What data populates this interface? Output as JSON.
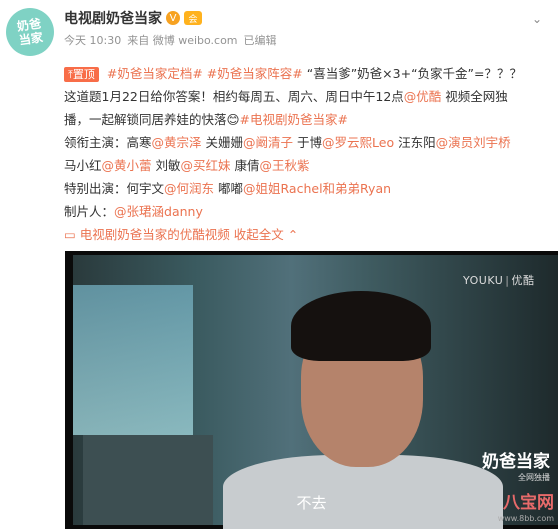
{
  "post": {
    "avatar_text": "奶爸当家",
    "username": "电视剧奶爸当家",
    "verified_badge": "V",
    "vip_badge": "会",
    "meta": {
      "time": "今天 10:30",
      "source": "来自 微博 weibo.com",
      "edited": "已编辑"
    },
    "more_icon": "chevron-down-icon"
  },
  "content": {
    "pin_label": "置顶",
    "line1": {
      "tag1": "#奶爸当家定档#",
      "tag2": "#奶爸当家阵容#",
      "text": "“喜当爹”奶爸×3+“负家千金”=？？？"
    },
    "line2": {
      "text": "这道题1月22日给你答案！相约每周五、周六、周日中午12点",
      "mention": "@优酷",
      "text2": " 视频全网独"
    },
    "line3": {
      "text": "播，一起解锁同居养娃的快落",
      "emoji": "😊",
      "tag": "#电视剧奶爸当家#"
    },
    "line4": {
      "label": "领衔主演：高寒",
      "m1": "@黄宗泽",
      "t1": " 关姗姗",
      "m2": "@阚清子",
      "t2": " 于博",
      "m3": "@罗云熙Leo",
      "t3": " 汪东阳",
      "m4": "@演员刘宇桥"
    },
    "line5": {
      "t1": "马小红",
      "m1": "@黄小蕾",
      "t2": " 刘敏",
      "m2": "@买红妹",
      "t3": " 康倩",
      "m3": "@王秋紫"
    },
    "line6": {
      "label": "特别出演：何宇文",
      "m1": "@何润东",
      "t1": " 嘟嘟",
      "m2": "@姐姐Rachel和弟弟Ryan"
    },
    "line7": {
      "label": "制片人：",
      "m1": "@张珺涵danny"
    },
    "video_link": "电视剧奶爸当家的优酷视频",
    "fold_label": "收起全文",
    "fold_icon": "chevron-up-icon"
  },
  "video": {
    "youku": "YOUKU",
    "youku_sep": "|",
    "youku_cn": "优酷",
    "subtitle": "不去",
    "show_logo": "奶爸当家",
    "show_logo_sub": "全网独播",
    "watermark": "八宝网",
    "watermark_url": "www.8bb.com"
  }
}
